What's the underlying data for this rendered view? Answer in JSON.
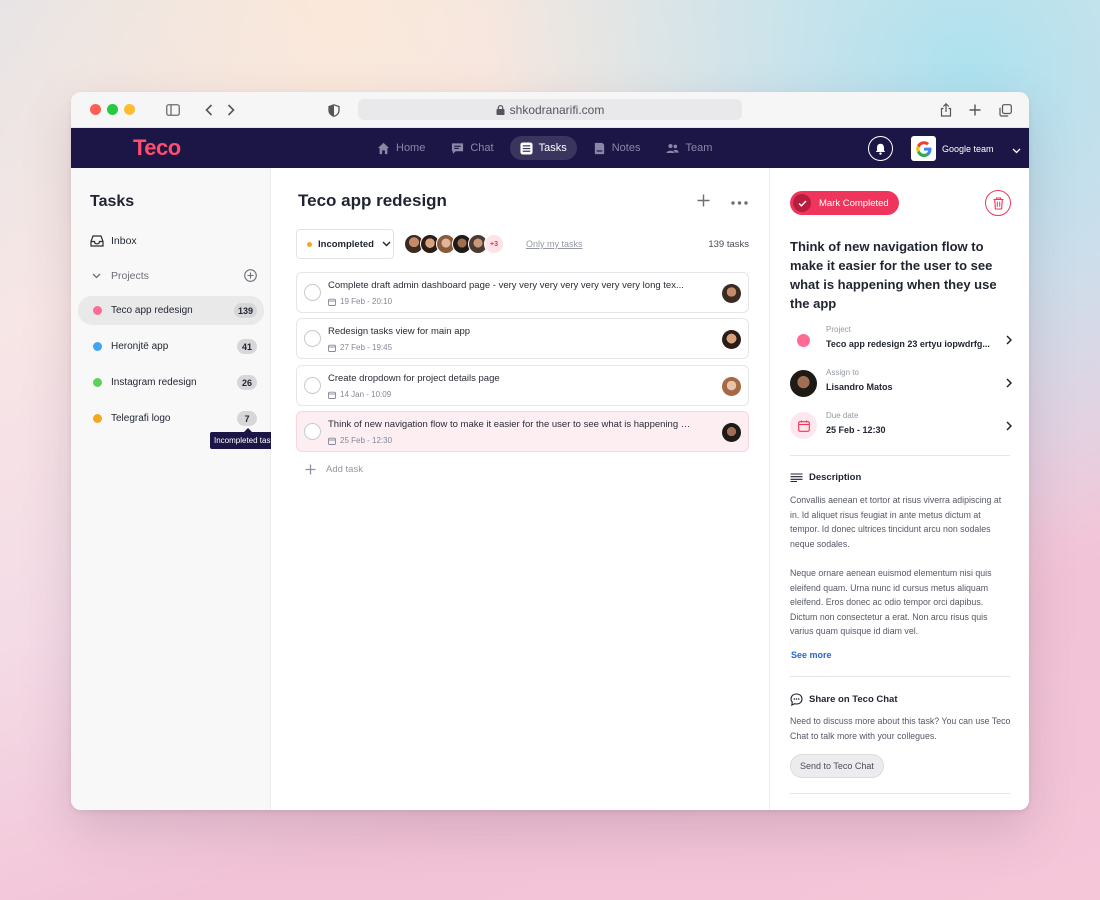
{
  "browser": {
    "url": "shkodranarifi.com"
  },
  "app": {
    "logo": "Teco",
    "nav": [
      {
        "label": "Home",
        "icon": "home-icon",
        "active": false
      },
      {
        "label": "Chat",
        "icon": "chat-icon",
        "active": false
      },
      {
        "label": "Tasks",
        "icon": "tasks-icon",
        "active": true
      },
      {
        "label": "Notes",
        "icon": "notes-icon",
        "active": false
      },
      {
        "label": "Team",
        "icon": "team-icon",
        "active": false
      }
    ],
    "team_name": "Google team",
    "brand_color": "#ff4d6d",
    "nav_bg": "#1c1646"
  },
  "sidebar": {
    "title": "Tasks",
    "inbox_label": "Inbox",
    "projects_label": "Projects",
    "projects": [
      {
        "name": "Teco app redesign",
        "count": "139",
        "color": "#ff6b95",
        "active": true
      },
      {
        "name": "Heronjtë app",
        "count": "41",
        "color": "#3ea6f2",
        "active": false
      },
      {
        "name": "Instagram redesign",
        "count": "26",
        "color": "#5dd15a",
        "active": false
      },
      {
        "name": "Telegrafi logo",
        "count": "7",
        "color": "#f5a623",
        "active": false
      }
    ],
    "tooltip": "Incompleted tasks"
  },
  "main": {
    "title": "Teco app redesign",
    "filter_label": "Incompleted",
    "more_members": "+3",
    "only_mine": "Only my tasks",
    "task_count": "139 tasks",
    "tasks": [
      {
        "title": "Complete draft admin dashboard page - very very very very very very very long tex...",
        "date": "19 Feb - 20:10",
        "highlight": false
      },
      {
        "title": "Redesign tasks view for main app",
        "date": "27 Feb - 19:45",
        "highlight": false
      },
      {
        "title": "Create dropdown for project details page",
        "date": "14 Jan - 10:09",
        "highlight": false
      },
      {
        "title": "Think of new navigation flow to make it easier for the user to see what is happening on...",
        "date": "25 Feb - 12:30",
        "highlight": true
      }
    ],
    "add_task": "Add task"
  },
  "detail": {
    "mark_completed": "Mark Completed",
    "title": "Think of new navigation flow to make it easier for the user to see what is happening when they use the app",
    "project_label": "Project",
    "project_value": "Teco app redesign 23 ertyu iopwdrfg...",
    "assign_label": "Assign to",
    "assign_value": "Lisandro Matos",
    "due_label": "Due date",
    "due_value": "25 Feb - 12:30",
    "description_label": "Description",
    "description_p1": "Convallis aenean et tortor at risus viverra adipiscing at in. Id aliquet risus feugiat in ante metus dictum at tempor. Id donec ultrices tincidunt arcu non sodales neque sodales.",
    "description_p2": "Neque ornare aenean euismod elementum nisi quis eleifend quam. Urna nunc id cursus metus aliquam eleifend. Eros donec ac odio tempor orci dapibus. Dictum non consectetur a erat. Non arcu risus quis varius quam quisque id diam vel.",
    "see_more": "See more",
    "share_label": "Share on Teco Chat",
    "share_text": "Need to discuss more about this task? You can use Teco Chat to talk more with your collegues.",
    "send_button": "Send to Teco Chat",
    "accent": "#f0355d"
  }
}
